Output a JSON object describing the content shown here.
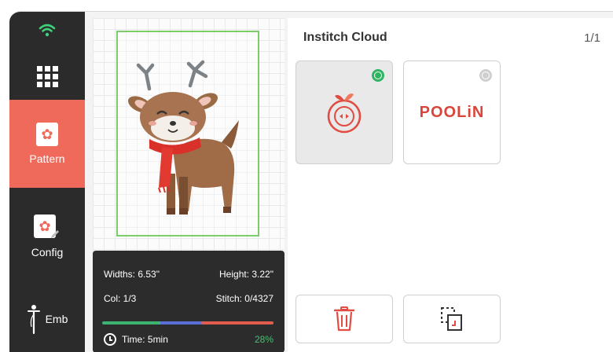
{
  "sidebar": {
    "items": [
      {
        "id": "wifi",
        "icon": "wifi-icon",
        "label": ""
      },
      {
        "id": "menu",
        "icon": "grid-menu-icon",
        "label": ""
      },
      {
        "id": "pattern",
        "icon": "pattern-icon",
        "label": "Pattern",
        "active": true
      },
      {
        "id": "config",
        "icon": "config-icon",
        "label": "Config"
      },
      {
        "id": "emb",
        "icon": "needle-icon",
        "label": "Emb"
      }
    ]
  },
  "preview": {
    "design_icon": "reindeer-embroidery-design",
    "info": {
      "widths_label": "Widths: 6.53\"",
      "height_label": "Height: 3.22\"",
      "col_label": "Col: 1/3",
      "stitch_label": "Stitch: 0/4327",
      "time_label": "Time: 5min",
      "percent": "28%",
      "progress_colors": [
        "#3cb371",
        "#5a6fd8",
        "#e25d4e"
      ]
    }
  },
  "cloud": {
    "title": "Institch Cloud",
    "page": "1/1",
    "cards": [
      {
        "icon": "instich-logo-icon",
        "status": "connected",
        "selected": true
      },
      {
        "icon": "poolin-logo",
        "brand": "POOLiN",
        "status": "disconnected",
        "selected": false
      }
    ],
    "actions": [
      {
        "icon": "trash-icon"
      },
      {
        "icon": "select-copy-icon"
      }
    ]
  },
  "colors": {
    "accent": "#ef6a5a",
    "sidebar_bg": "#2b2b2b",
    "status_on": "#2fb463",
    "hoop_border": "#7ccc6a"
  }
}
